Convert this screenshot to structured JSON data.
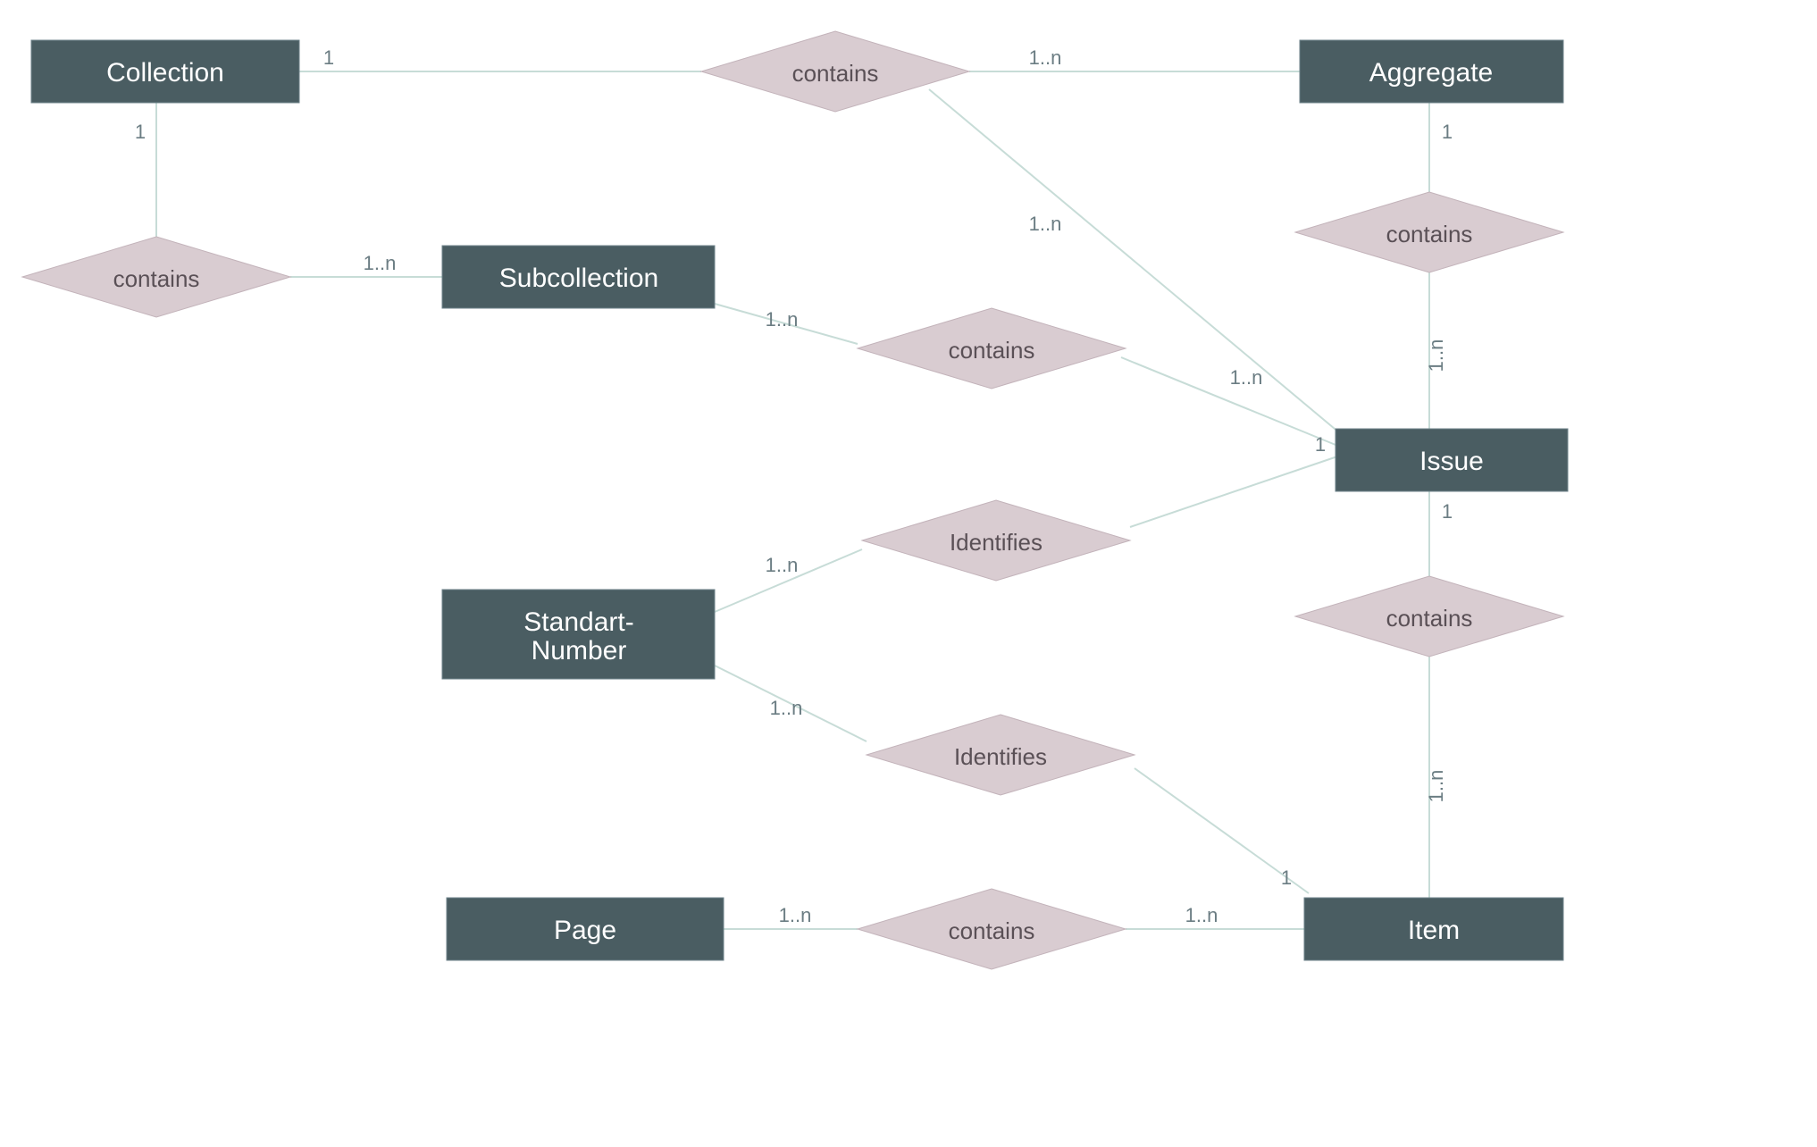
{
  "entities": {
    "collection": "Collection",
    "aggregate": "Aggregate",
    "subcollection": "Subcollection",
    "issue": "Issue",
    "standart_number_l1": "Standart-",
    "standart_number_l2": "Number",
    "page": "Page",
    "item": "Item"
  },
  "relationships": {
    "contains": "contains",
    "identifies": "Identifies"
  },
  "card": {
    "one": "1",
    "one_n": "1..n"
  }
}
